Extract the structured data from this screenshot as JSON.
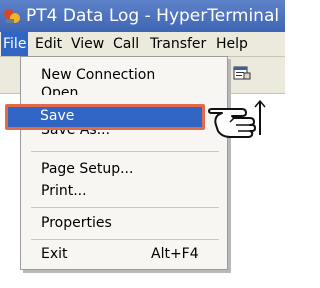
{
  "window": {
    "title": "PT4 Data Log - HyperTerminal"
  },
  "menubar": {
    "items": [
      {
        "label": "File"
      },
      {
        "label": "Edit"
      },
      {
        "label": "View"
      },
      {
        "label": "Call"
      },
      {
        "label": "Transfer"
      },
      {
        "label": "Help"
      }
    ]
  },
  "file_menu": {
    "new_connection": "New Connection",
    "open": "Open",
    "save": "Save",
    "save_as": "Save As...",
    "page_setup": "Page Setup...",
    "print": "Print...",
    "properties": "Properties",
    "exit": "Exit",
    "exit_shortcut": "Alt+F4"
  },
  "icons": {
    "app": "hyperterminal-icon",
    "toolbar": "properties-icon",
    "pointer": "pointing-hand-icon"
  },
  "colors": {
    "highlight": "#3165c5",
    "callout": "#e06a4a",
    "titlebar": "#4a70bd"
  }
}
